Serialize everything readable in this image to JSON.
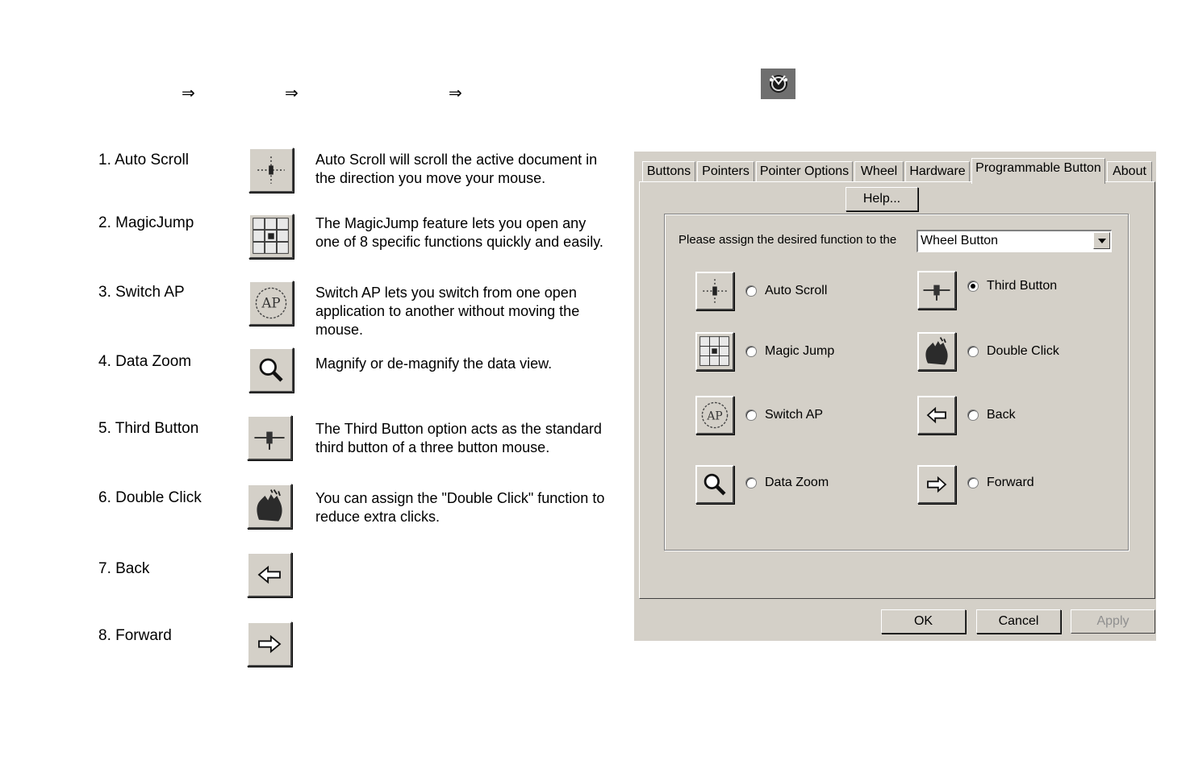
{
  "header": {
    "arrows": [
      "⇒",
      "⇒",
      "⇒"
    ],
    "logo_icon": "mouse-logo-icon"
  },
  "features": [
    {
      "label": "1. Auto Scroll",
      "icon": "auto-scroll-icon",
      "desc": "Auto Scroll will scroll the active document in the direction you move your mouse."
    },
    {
      "label": "2. MagicJump",
      "icon": "magic-jump-icon",
      "desc": "The MagicJump feature lets you open any one of 8 specific functions quickly and easily."
    },
    {
      "label": "3. Switch AP",
      "icon": "switch-ap-icon",
      "desc": "Switch AP lets you switch from one open application to another without moving the mouse."
    },
    {
      "label": "4. Data Zoom",
      "icon": "magnifier-icon",
      "desc": "Magnify or de-magnify the data view."
    },
    {
      "label": "5. Third Button",
      "icon": "third-button-icon",
      "desc": "The Third Button option acts as the standard third button of a three button mouse."
    },
    {
      "label": "6. Double Click",
      "icon": "hand-icon",
      "desc": "You can assign the \"Double Click\" function to reduce extra clicks."
    },
    {
      "label": "7. Back",
      "icon": "left-arrow-icon",
      "desc": ""
    },
    {
      "label": "8. Forward",
      "icon": "right-arrow-icon",
      "desc": ""
    }
  ],
  "dialog": {
    "tabs": [
      "Buttons",
      "Pointers",
      "Pointer Options",
      "Wheel",
      "Hardware",
      "Programmable Button",
      "About"
    ],
    "active_tab": "Programmable Button",
    "help_label": "Help...",
    "assign_label": "Please assign the desired function to the",
    "combo_value": "Wheel Button",
    "options": [
      {
        "label": "Auto Scroll",
        "icon": "auto-scroll-icon",
        "selected": false
      },
      {
        "label": "Third Button",
        "icon": "third-button-icon",
        "selected": true
      },
      {
        "label": "Magic Jump",
        "icon": "magic-jump-icon",
        "selected": false
      },
      {
        "label": "Double Click",
        "icon": "hand-icon",
        "selected": false
      },
      {
        "label": "Switch AP",
        "icon": "switch-ap-icon",
        "selected": false
      },
      {
        "label": "Back",
        "icon": "left-arrow-icon",
        "selected": false
      },
      {
        "label": "Data Zoom",
        "icon": "magnifier-icon",
        "selected": false
      },
      {
        "label": "Forward",
        "icon": "right-arrow-icon",
        "selected": false
      }
    ],
    "ok_label": "OK",
    "cancel_label": "Cancel",
    "apply_label": "Apply"
  }
}
